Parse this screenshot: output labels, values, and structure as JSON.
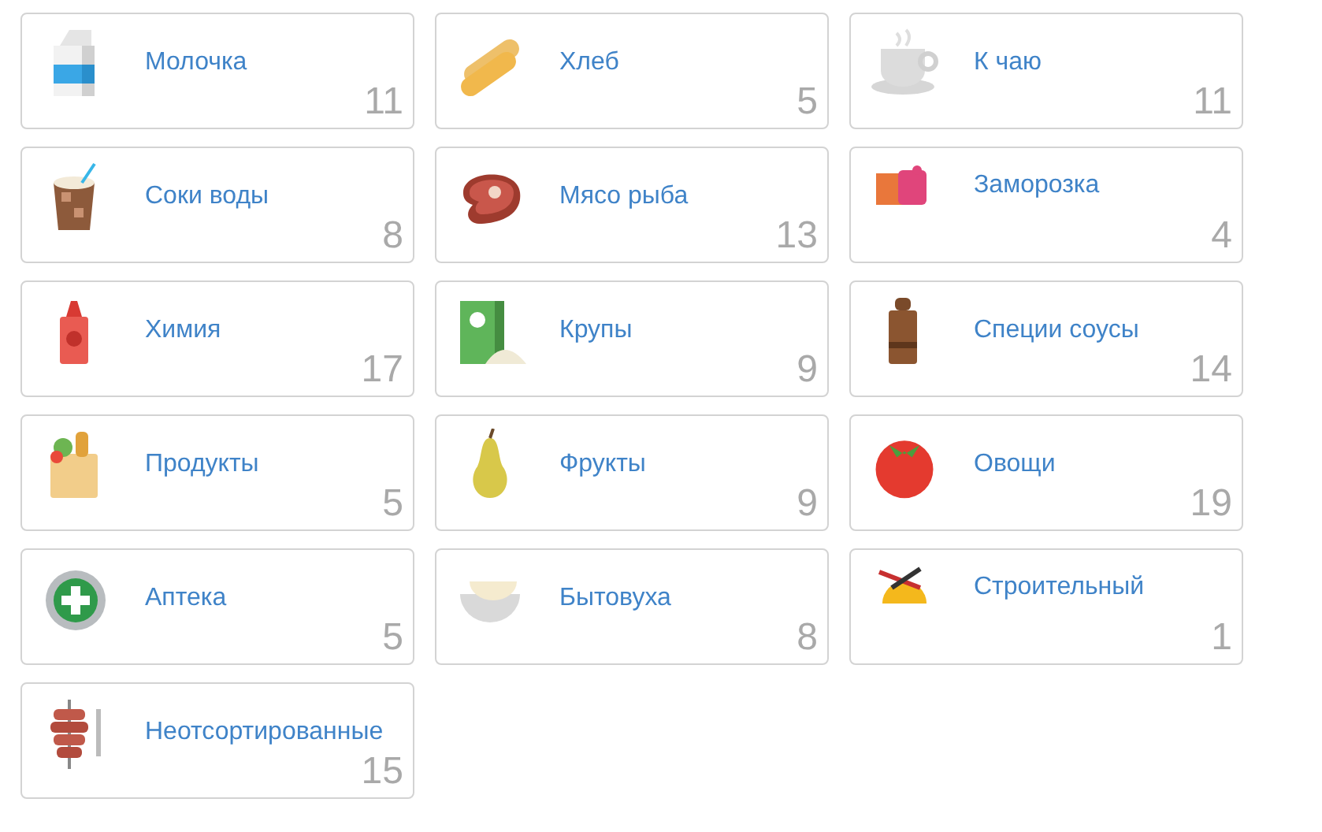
{
  "categories": [
    {
      "label": "Молочка",
      "count": "11"
    },
    {
      "label": "Хлеб",
      "count": "5"
    },
    {
      "label": "К чаю",
      "count": "11"
    },
    {
      "label": "Соки воды",
      "count": "8"
    },
    {
      "label": "Мясо рыба",
      "count": "13"
    },
    {
      "label": "Заморозка",
      "count": "4"
    },
    {
      "label": "Химия",
      "count": "17"
    },
    {
      "label": "Крупы",
      "count": "9"
    },
    {
      "label": "Специи соусы",
      "count": "14"
    },
    {
      "label": "Продукты",
      "count": "5"
    },
    {
      "label": "Фрукты",
      "count": "9"
    },
    {
      "label": "Овощи",
      "count": "19"
    },
    {
      "label": "Аптека",
      "count": "5"
    },
    {
      "label": "Бытовуха",
      "count": "8"
    },
    {
      "label": "Строительный",
      "count": "1"
    },
    {
      "label": "Неотсортированные",
      "count": "15"
    }
  ]
}
